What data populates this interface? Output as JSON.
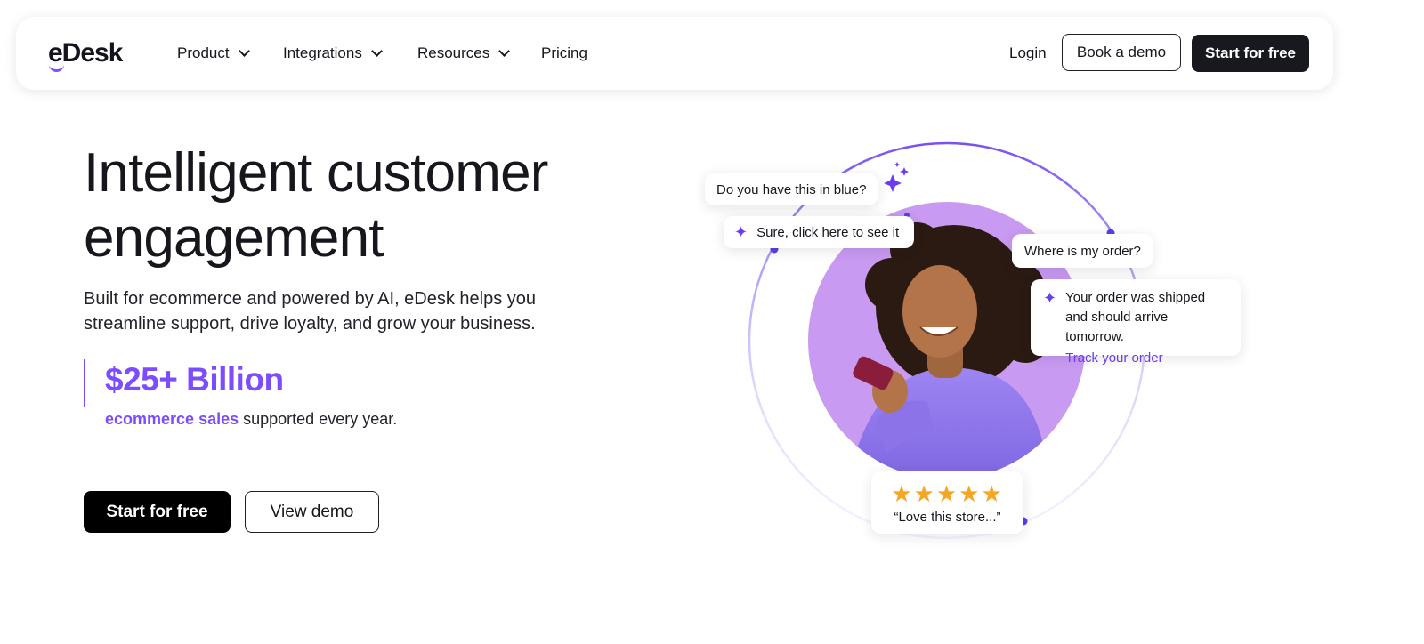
{
  "brand": {
    "logo_text": "eDesk",
    "accent": "#7c4dff"
  },
  "nav": {
    "items": [
      {
        "label": "Product",
        "has_dropdown": true
      },
      {
        "label": "Integrations",
        "has_dropdown": true
      },
      {
        "label": "Resources",
        "has_dropdown": true
      },
      {
        "label": "Pricing",
        "has_dropdown": false
      }
    ],
    "login_label": "Login",
    "book_demo_label": "Book a demo",
    "start_free_label": "Start for free"
  },
  "hero": {
    "headline": "Intelligent customer engagement",
    "subtext": "Built for ecommerce and powered by AI, eDesk helps you streamline support, drive loyalty, and grow your business.",
    "stat_value": "$25+ Billion",
    "stat_highlight": "ecommerce sales",
    "stat_rest": "supported every year.",
    "cta_primary": "Start for free",
    "cta_secondary": "View demo"
  },
  "illustration": {
    "chat_question_1": "Do you have this in blue?",
    "chat_answer_1": "Sure, click here to see it",
    "chat_question_2": "Where is my order?",
    "chat_answer_2": "Your order was shipped and should arrive tomorrow.",
    "chat_answer_2_link": "Track your order",
    "review_stars": "★★★★★",
    "review_rating": 5,
    "review_text": "“Love this store...”"
  }
}
